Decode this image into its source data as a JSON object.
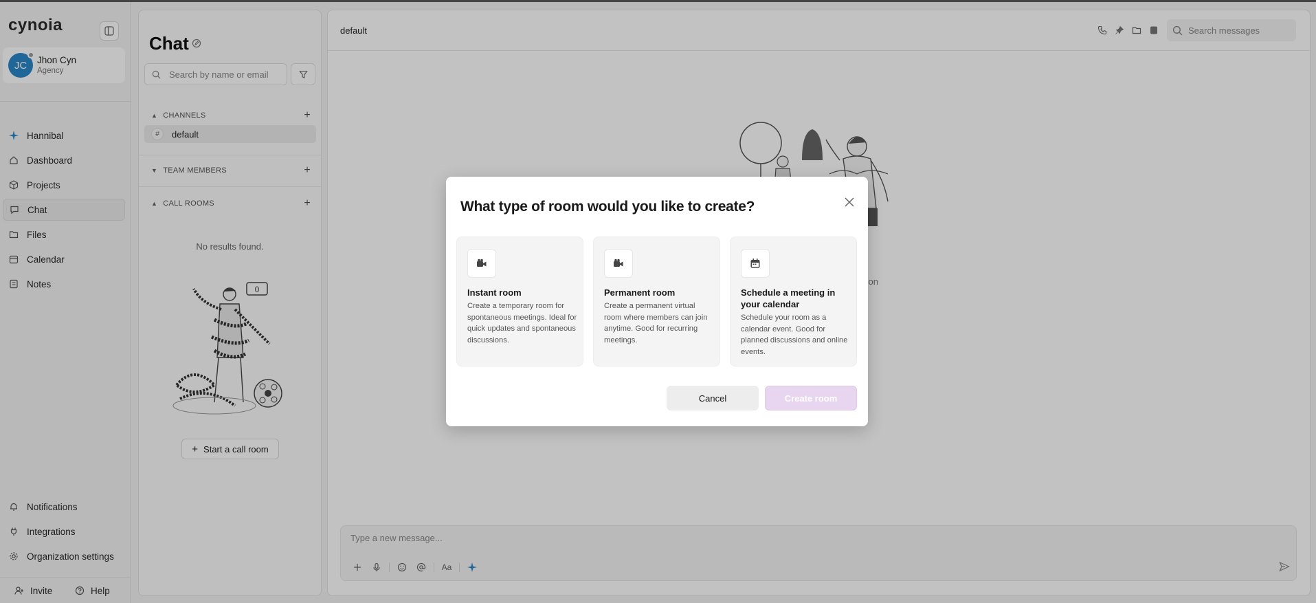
{
  "sidebar": {
    "logo": "cynoia",
    "user": {
      "initials": "JC",
      "name": "Jhon Cyn",
      "role": "Agency"
    },
    "nav": [
      {
        "label": "Hannibal",
        "icon": "sparkle-icon"
      },
      {
        "label": "Dashboard",
        "icon": "home-icon"
      },
      {
        "label": "Projects",
        "icon": "cube-icon"
      },
      {
        "label": "Chat",
        "icon": "chat-icon",
        "active": true
      },
      {
        "label": "Files",
        "icon": "folder-icon"
      },
      {
        "label": "Calendar",
        "icon": "calendar-icon"
      },
      {
        "label": "Notes",
        "icon": "note-icon"
      }
    ],
    "bottom_nav": [
      {
        "label": "Notifications",
        "icon": "bell-icon"
      },
      {
        "label": "Integrations",
        "icon": "plug-icon"
      },
      {
        "label": "Organization settings",
        "icon": "gear-icon"
      }
    ],
    "invite_label": "Invite",
    "help_label": "Help"
  },
  "chatlist": {
    "title": "Chat",
    "search_placeholder": "Search by name or email",
    "sections": {
      "channels": "CHANNELS",
      "team_members": "TEAM MEMBERS",
      "call_rooms": "CALL ROOMS"
    },
    "channels": [
      {
        "name": "default"
      }
    ],
    "no_results": "No results found.",
    "badge_count": "0",
    "start_call_label": "Start a call room"
  },
  "main": {
    "room_name": "default",
    "search_placeholder": "Search messages",
    "empty_text_fragment": "tion",
    "composer_placeholder": "Type a new message...",
    "format_label": "Aa"
  },
  "modal": {
    "title": "What type of room would you like to create?",
    "options": [
      {
        "title": "Instant room",
        "desc": "Create a temporary room for spontaneous meetings. Ideal for quick updates and spontaneous discussions.",
        "icon": "video-camera-icon"
      },
      {
        "title": "Permanent room",
        "desc": "Create a permanent virtual room where members can join anytime. Good for recurring meetings.",
        "icon": "video-camera-icon"
      },
      {
        "title": "Schedule a meeting in your calendar",
        "desc": "Schedule your room as a calendar event. Good for planned discussions and online events.",
        "icon": "calendar-icon"
      }
    ],
    "cancel_label": "Cancel",
    "create_label": "Create room"
  },
  "colors": {
    "accent": "#2a86c9",
    "create_button": "#e8d6f0"
  }
}
